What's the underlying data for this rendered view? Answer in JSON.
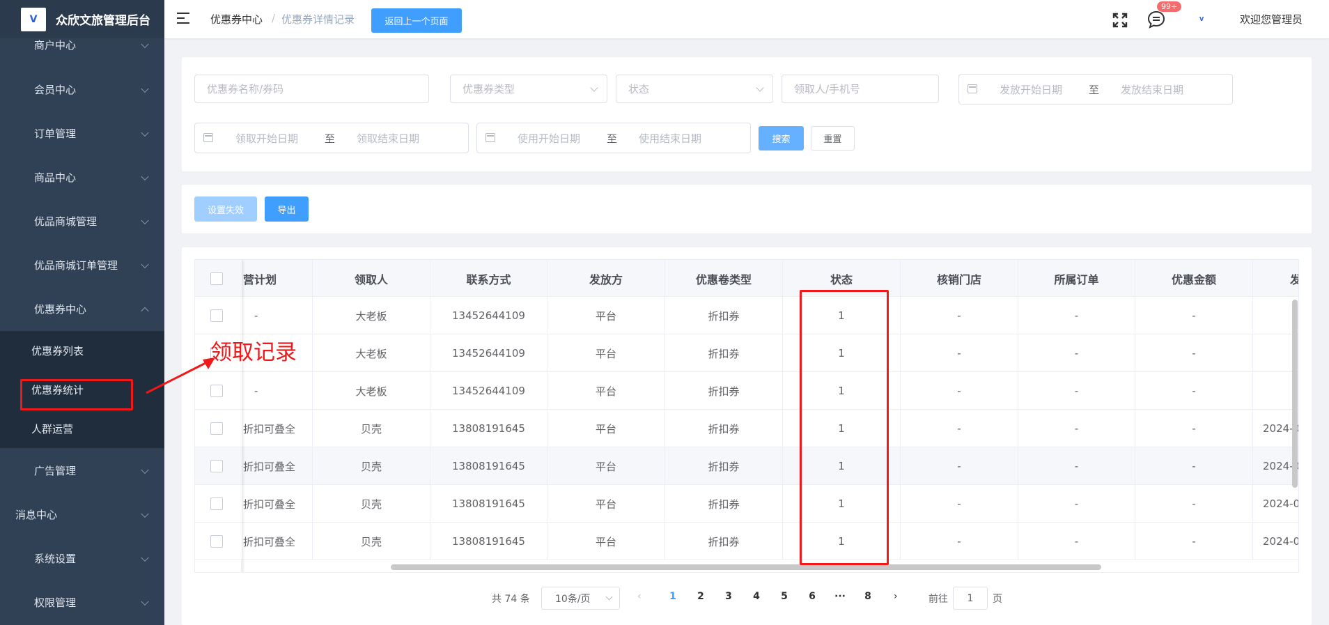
{
  "app": {
    "title": "众欣文旅管理后台",
    "logo_text": "V"
  },
  "sidebar": {
    "items": [
      {
        "label": "商户中心"
      },
      {
        "label": "会员中心"
      },
      {
        "label": "订单管理"
      },
      {
        "label": "商品中心"
      },
      {
        "label": "优品商城管理"
      },
      {
        "label": "优品商城订单管理"
      },
      {
        "label": "优惠券中心",
        "expanded": true
      },
      {
        "label": "广告管理"
      },
      {
        "label": "消息中心"
      },
      {
        "label": "系统设置"
      },
      {
        "label": "权限管理"
      }
    ],
    "submenu": [
      {
        "label": "优惠券列表"
      },
      {
        "label": "优惠券统计"
      },
      {
        "label": "人群运营"
      }
    ]
  },
  "header": {
    "breadcrumb": [
      "优惠券中心",
      "优惠券详情记录"
    ],
    "separator": "/",
    "back_button": "返回上一个页面",
    "badge": "99+",
    "avatar_text": "V",
    "welcome": "欢迎您管理员"
  },
  "filters": {
    "name_placeholder": "优惠券名称/券码",
    "type_placeholder": "优惠券类型",
    "status_placeholder": "状态",
    "receiver_placeholder": "领取人/手机号",
    "issue_start": "发放开始日期",
    "issue_end": "发放结束日期",
    "claim_start": "领取开始日期",
    "claim_end": "领取结束日期",
    "use_start": "使用开始日期",
    "use_end": "使用结束日期",
    "range_to": "至",
    "search_button": "搜索",
    "reset_button": "重置"
  },
  "actions": {
    "disable_button": "设置失效",
    "export_button": "导出"
  },
  "table": {
    "columns": [
      "营计划",
      "领取人",
      "联系方式",
      "发放方",
      "优惠卷类型",
      "状态",
      "核销门店",
      "所属订单",
      "优惠金额",
      "发"
    ],
    "rows": [
      [
        "-",
        "大老板",
        "13452644109",
        "平台",
        "折扣券",
        "1",
        "-",
        "-",
        "-",
        ""
      ],
      [
        "",
        "大老板",
        "13452644109",
        "平台",
        "折扣券",
        "1",
        "-",
        "-",
        "-",
        ""
      ],
      [
        "-",
        "大老板",
        "13452644109",
        "平台",
        "折扣券",
        "1",
        "-",
        "-",
        "-",
        ""
      ],
      [
        "折扣可叠全",
        "贝壳",
        "13808191645",
        "平台",
        "折扣券",
        "1",
        "-",
        "-",
        "-",
        "2024-0"
      ],
      [
        "折扣可叠全",
        "贝壳",
        "13808191645",
        "平台",
        "折扣券",
        "1",
        "-",
        "-",
        "-",
        "2024-0"
      ],
      [
        "折扣可叠全",
        "贝壳",
        "13808191645",
        "平台",
        "折扣券",
        "1",
        "-",
        "-",
        "-",
        "2024-0"
      ],
      [
        "折扣可叠全",
        "贝壳",
        "13808191645",
        "平台",
        "折扣券",
        "1",
        "-",
        "-",
        "-",
        "2024-0"
      ]
    ]
  },
  "pagination": {
    "total": "共 74 条",
    "page_size": "10条/页",
    "pages": [
      "1",
      "2",
      "3",
      "4",
      "5",
      "6",
      "···",
      "8"
    ],
    "current": "1",
    "goto_label": "前往",
    "goto_value": "1",
    "page_unit": "页"
  },
  "annotation": {
    "label": "领取记录",
    "color": "#f01818"
  },
  "colors": {
    "sidebar_bg": "#304156",
    "primary": "#409eff",
    "annotation": "#f01818"
  }
}
